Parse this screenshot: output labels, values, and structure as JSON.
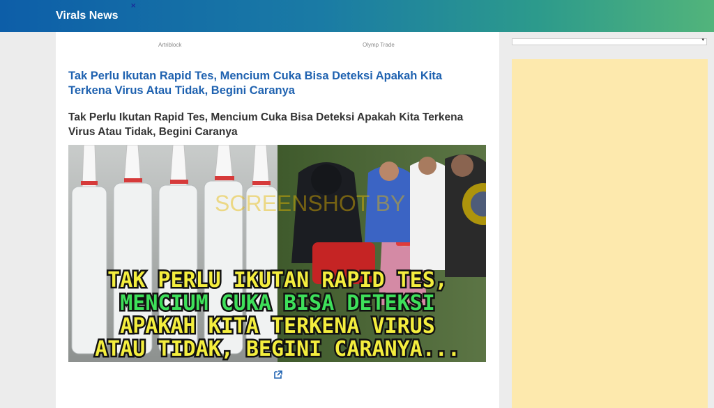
{
  "header": {
    "brand": "Virals News",
    "close_glyph": "×"
  },
  "ads": {
    "label_1": "Artriblock",
    "label_2": "Olymp Trade"
  },
  "article": {
    "headline": "Tak Perlu Ikutan Rapid Tes, Mencium Cuka Bisa Deteksi Apakah Kita Terkena Virus Atau Tidak, Begini Caranya",
    "subheading": "Tak Perlu Ikutan Rapid Tes, Mencium Cuka Bisa Deteksi Apakah Kita Terkena Virus Atau Tidak, Begini Caranya",
    "image_caption_lines": [
      "TAK PERLU IKUTAN RAPID TES,",
      "MENCIUM CUKA BISA DETEKSI",
      "APAKAH KITA TERKENA VIRUS",
      "ATAU TIDAK, BEGINI CARANYA..."
    ],
    "watermark": "SCREENSHOT BY",
    "link_icon": "external-link-icon"
  },
  "colors": {
    "headline": "#1f62b0",
    "caption_yellow": "#f4ee3e",
    "caption_green": "#3ee05a",
    "sidebar_ad": "#fde9ad"
  }
}
